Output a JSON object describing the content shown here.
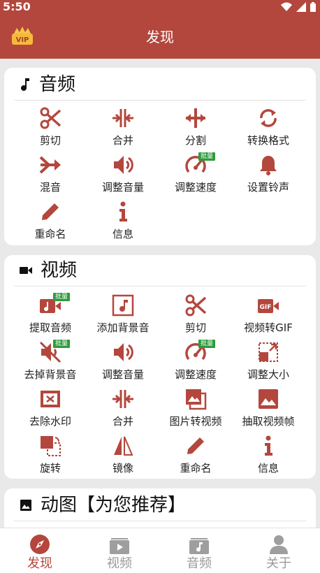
{
  "status_bar": {
    "time": "5:50"
  },
  "app_bar": {
    "title": "发现",
    "vip_label": "VIP"
  },
  "colors": {
    "primary": "#b3473d",
    "batch_badge": "#2e9a3c",
    "inactive": "#999999"
  },
  "audio_section": {
    "title": "音频",
    "icon": "music-note-icon",
    "items": [
      {
        "label": "剪切",
        "icon": "scissors-icon",
        "badge": ""
      },
      {
        "label": "合并",
        "icon": "merge-icon",
        "badge": ""
      },
      {
        "label": "分割",
        "icon": "split-icon",
        "badge": ""
      },
      {
        "label": "转换格式",
        "icon": "convert-icon",
        "badge": ""
      },
      {
        "label": "混音",
        "icon": "mix-icon",
        "badge": ""
      },
      {
        "label": "调整音量",
        "icon": "volume-icon",
        "badge": ""
      },
      {
        "label": "调整速度",
        "icon": "speed-icon",
        "badge": "批量"
      },
      {
        "label": "设置铃声",
        "icon": "bell-icon",
        "badge": ""
      },
      {
        "label": "重命名",
        "icon": "pencil-icon",
        "badge": ""
      },
      {
        "label": "信息",
        "icon": "info-icon",
        "badge": ""
      }
    ]
  },
  "video_section": {
    "title": "视频",
    "icon": "video-camera-icon",
    "items": [
      {
        "label": "提取音频",
        "icon": "extract-audio-icon",
        "badge": "批量"
      },
      {
        "label": "添加背景音",
        "icon": "add-music-icon",
        "badge": ""
      },
      {
        "label": "剪切",
        "icon": "scissors-icon",
        "badge": ""
      },
      {
        "label": "视频转GIF",
        "icon": "gif-icon",
        "badge": "",
        "icon_text": "GIF"
      },
      {
        "label": "去掉背景音",
        "icon": "mute-icon",
        "badge": "批量"
      },
      {
        "label": "调整音量",
        "icon": "volume-icon",
        "badge": ""
      },
      {
        "label": "调整速度",
        "icon": "speed-icon",
        "badge": "批量"
      },
      {
        "label": "调整大小",
        "icon": "resize-icon",
        "badge": ""
      },
      {
        "label": "去除水印",
        "icon": "watermark-icon",
        "badge": ""
      },
      {
        "label": "合并",
        "icon": "merge-icon",
        "badge": ""
      },
      {
        "label": "图片转视频",
        "icon": "photos-icon",
        "badge": ""
      },
      {
        "label": "抽取视频帧",
        "icon": "image-icon",
        "badge": ""
      },
      {
        "label": "旋转",
        "icon": "rotate-icon",
        "badge": ""
      },
      {
        "label": "镜像",
        "icon": "mirror-icon",
        "badge": ""
      },
      {
        "label": "重命名",
        "icon": "pencil-icon",
        "badge": ""
      },
      {
        "label": "信息",
        "icon": "info-icon",
        "badge": ""
      }
    ]
  },
  "gif_section": {
    "title": "动图【为您推荐】",
    "icon": "image-icon"
  },
  "bottom_nav": {
    "items": [
      {
        "label": "发现",
        "icon": "compass-icon",
        "active": true
      },
      {
        "label": "视频",
        "icon": "video-folder-icon",
        "active": false
      },
      {
        "label": "音频",
        "icon": "audio-folder-icon",
        "active": false
      },
      {
        "label": "关于",
        "icon": "person-icon",
        "active": false
      }
    ]
  }
}
